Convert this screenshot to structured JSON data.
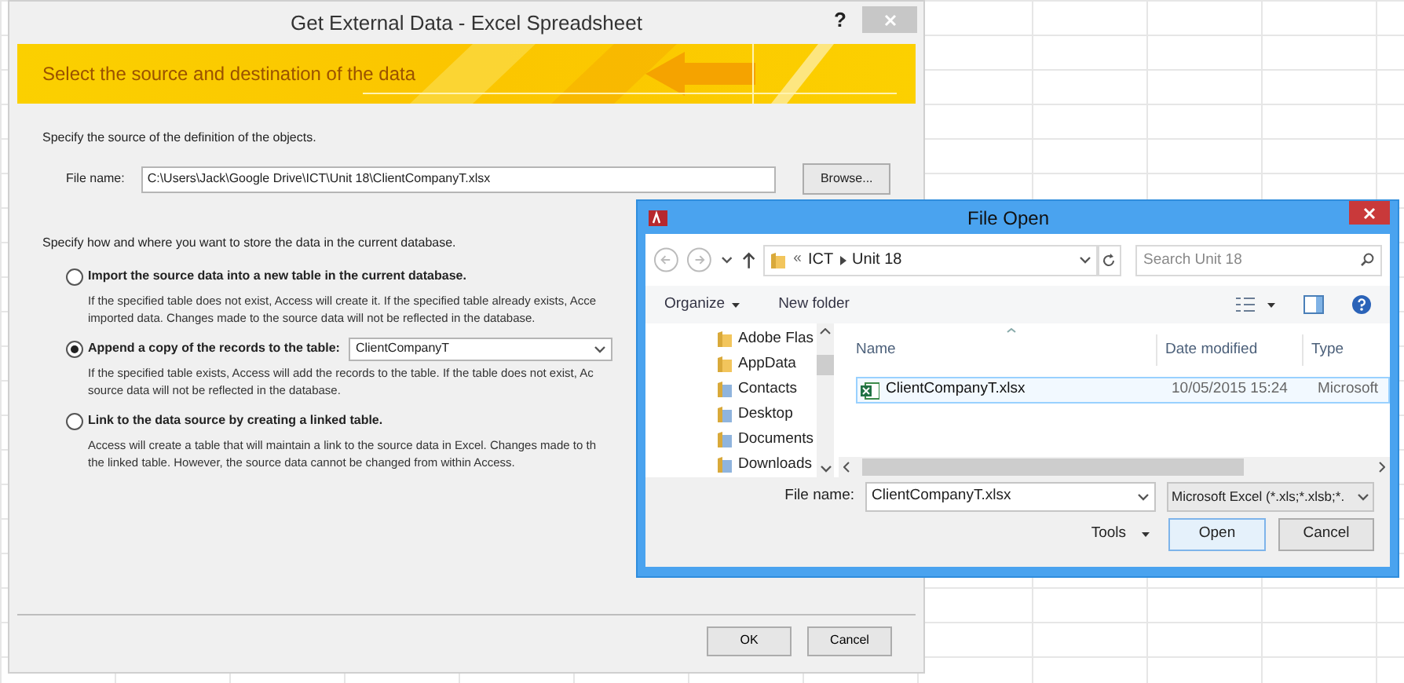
{
  "import_dialog": {
    "title": "Get External Data - Excel Spreadsheet",
    "help": "?",
    "banner": "Select the source and destination of the data",
    "source_prompt": "Specify the source of the definition of the objects.",
    "file_name_label": "File name:",
    "file_name_value": "C:\\Users\\Jack\\Google Drive\\ICT\\Unit 18\\ClientCompanyT.xlsx",
    "browse_button": "Browse...",
    "store_prompt": "Specify how and where you want to store the data in the current database.",
    "options": [
      {
        "kind": "plain",
        "label": "Import the source data into a new table in the current database.",
        "selected": false,
        "description": "If the specified table does not exist, Access will create it. If the specified table already exists, Acce\nimported data. Changes made to the source data will not be reflected in the database."
      },
      {
        "kind": "table_select",
        "label": "Append a copy of the records to the table:",
        "selected": true,
        "table_value": "ClientCompanyT",
        "description": "If the specified table exists, Access will add the records to the table. If the table does not exist, Ac\nsource data will not be reflected in the database."
      },
      {
        "kind": "plain",
        "label": "Link to the data source by creating a linked table.",
        "selected": false,
        "description": "Access will create a table that will maintain a link to the source data in Excel. Changes made to th\nthe linked table. However, the source data cannot be changed from within Access."
      }
    ],
    "ok_button": "OK",
    "cancel_button": "Cancel"
  },
  "file_open_dialog": {
    "title": "File Open",
    "path_overflow": "«",
    "path": [
      "ICT",
      "Unit 18"
    ],
    "search_placeholder": "Search Unit 18",
    "organize": "Organize",
    "new_folder": "New folder",
    "nav_items": [
      {
        "label": "Adobe Flas"
      },
      {
        "label": "AppData"
      },
      {
        "label": "Contacts"
      },
      {
        "label": "Desktop"
      },
      {
        "label": "Documents"
      },
      {
        "label": "Downloads"
      }
    ],
    "columns": [
      "Name",
      "Date modified",
      "Type"
    ],
    "rows": [
      {
        "name": "ClientCompanyT.xlsx",
        "date": "10/05/2015 15:24",
        "type": "Microsoft",
        "selected": true
      }
    ],
    "file_name_label": "File name:",
    "file_name_value": "ClientCompanyT.xlsx",
    "file_type": "Microsoft Excel (*.xls;*.xlsb;*.",
    "tools": "Tools",
    "open_button": "Open",
    "cancel_button": "Cancel"
  }
}
